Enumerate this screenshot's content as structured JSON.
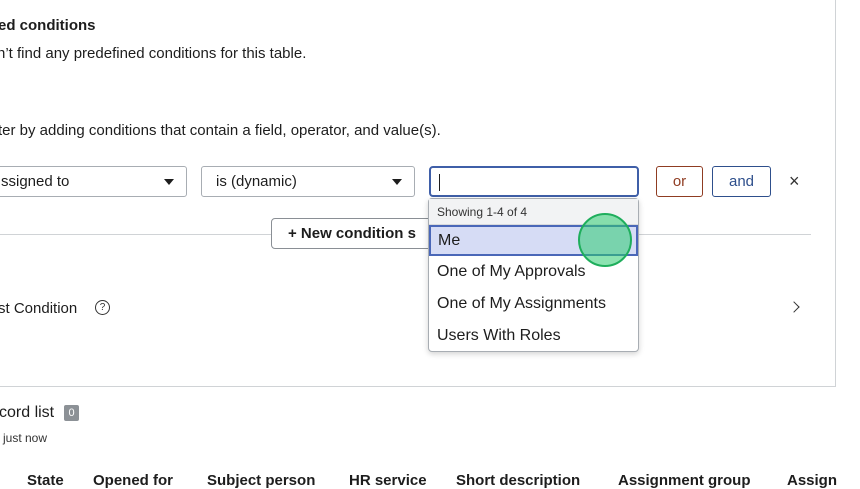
{
  "predefined": {
    "title": "ed conditions",
    "message": "n’t find any predefined conditions for this table."
  },
  "instructions": "ter by adding conditions that contain a field, operator, and value(s).",
  "condition_row": {
    "field_value": "ssigned to",
    "operator_value": "is (dynamic)",
    "value_input": "",
    "or_label": "or",
    "and_label": "and",
    "remove_glyph": "×"
  },
  "new_condition_label": "+ New condition s",
  "dropdown": {
    "header": "Showing 1-4 of 4",
    "options": [
      "Me",
      "One of My Approvals",
      "One of My Assignments",
      "Users With Roles"
    ],
    "selected_index": 0
  },
  "list_condition": {
    "label": "st Condition",
    "help_glyph": "?"
  },
  "record_list": {
    "title": "cord list",
    "count": "0",
    "updated": "just now"
  },
  "table": {
    "columns": [
      "State",
      "Opened for",
      "Subject person",
      "HR service",
      "Short description",
      "Assignment group",
      "Assign"
    ]
  },
  "colors": {
    "or_button": "#8f3c22",
    "and_button": "#2e4f8c",
    "selected_option_bg": "#d6dcf5",
    "focus_border": "#3f5fa8"
  }
}
